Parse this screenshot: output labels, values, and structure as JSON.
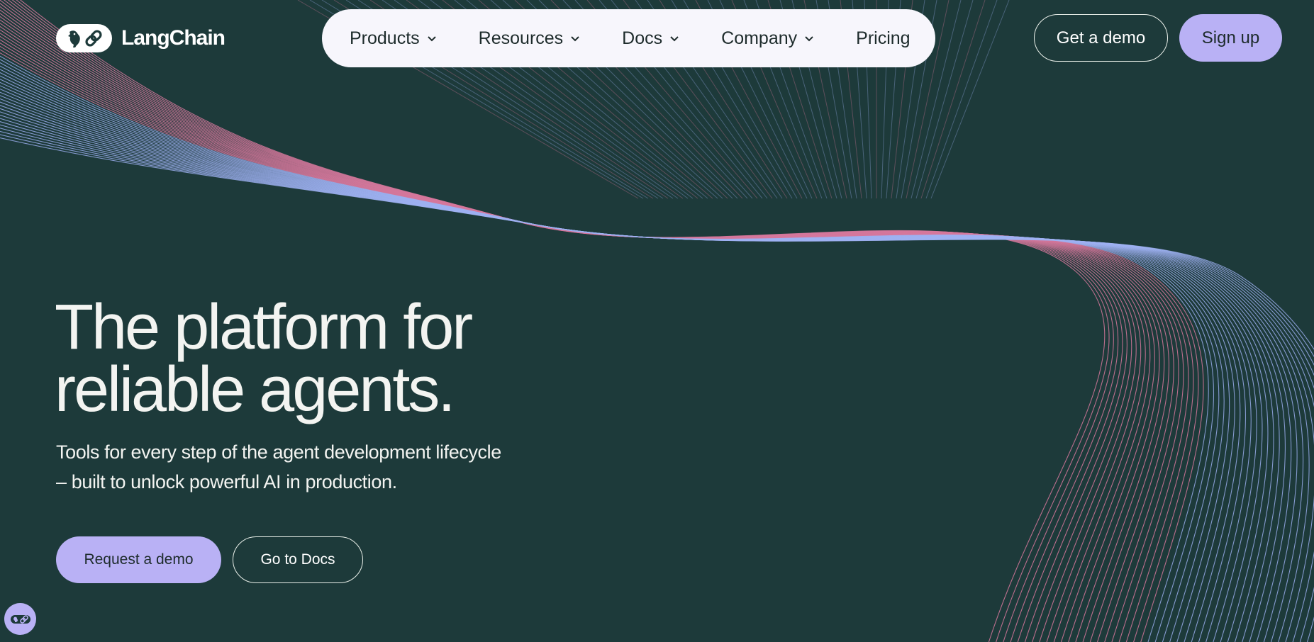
{
  "brand": {
    "name": "LangChain",
    "logo_icon": "parrot-link-icon"
  },
  "nav": {
    "items": [
      {
        "label": "Products",
        "has_dropdown": true
      },
      {
        "label": "Resources",
        "has_dropdown": true
      },
      {
        "label": "Docs",
        "has_dropdown": true
      },
      {
        "label": "Company",
        "has_dropdown": true
      },
      {
        "label": "Pricing",
        "has_dropdown": false
      }
    ]
  },
  "header_actions": {
    "get_demo_label": "Get a demo",
    "sign_up_label": "Sign up"
  },
  "hero": {
    "title_line1": "The platform for",
    "title_line2": "reliable agents.",
    "subtitle_line1": "Tools for every step of the agent development lifecycle",
    "subtitle_line2": "– built to unlock powerful AI in production.",
    "primary_cta": "Request a demo",
    "secondary_cta": "Go to Docs"
  },
  "widget": {
    "icon": "parrot-link-icon"
  },
  "colors": {
    "background": "#1d3a3a",
    "accent": "#b9b1f5",
    "nav_bg": "#f7f6fc",
    "text_light": "#f3f4f1",
    "line_blue": "#9fb1f2",
    "line_pink": "#d6789c"
  }
}
